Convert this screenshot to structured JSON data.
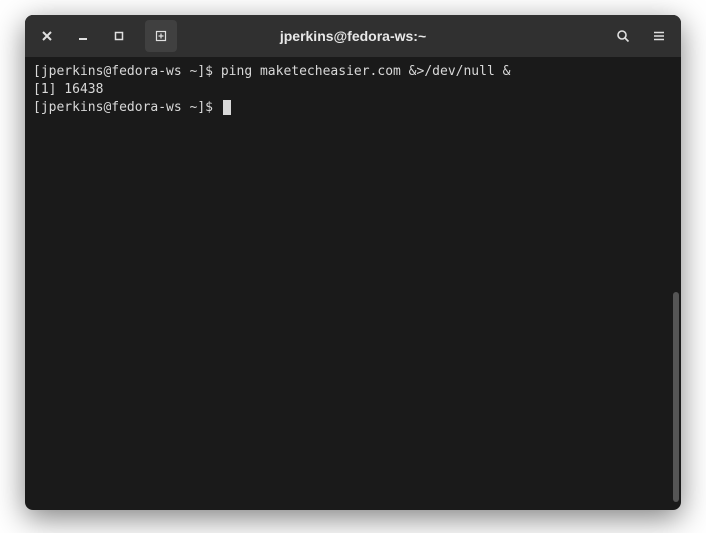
{
  "title": "jperkins@fedora-ws:~",
  "terminal": {
    "line1_prompt": "[jperkins@fedora-ws ~]$ ",
    "line1_cmd": "ping maketecheasier.com &>/dev/null &",
    "line2": "[1] 16438",
    "line3_prompt": "[jperkins@fedora-ws ~]$ "
  }
}
